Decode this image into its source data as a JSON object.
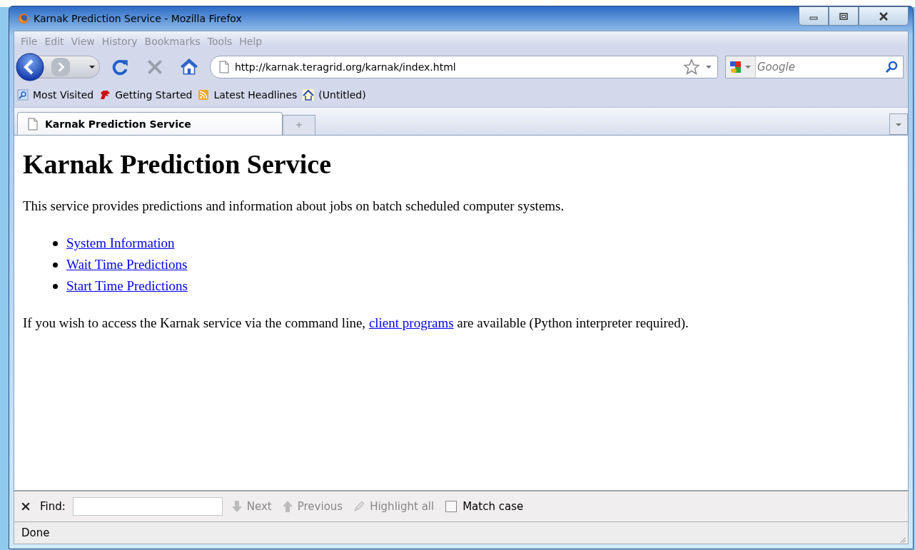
{
  "window": {
    "title": "Karnak Prediction Service - Mozilla Firefox"
  },
  "menu": [
    "File",
    "Edit",
    "View",
    "History",
    "Bookmarks",
    "Tools",
    "Help"
  ],
  "address": {
    "value": "http://karnak.teragrid.org/karnak/index.html"
  },
  "search": {
    "placeholder": "Google"
  },
  "bookmarks": [
    {
      "label": "Most Visited",
      "kind": "search"
    },
    {
      "label": "Getting Started",
      "kind": "dino"
    },
    {
      "label": "Latest Headlines",
      "kind": "feed"
    },
    {
      "label": "(Untitled)",
      "kind": "home"
    }
  ],
  "tabs": [
    {
      "label": "Karnak Prediction Service",
      "selected": true
    }
  ],
  "page": {
    "heading": "Karnak Prediction Service",
    "intro": "This service provides predictions and information about jobs on batch scheduled computer systems.",
    "links": [
      "System Information",
      "Wait Time Predictions",
      "Start Time Predictions"
    ],
    "footer_before": "If you wish to access the Karnak service via the command line,",
    "footer_link": "client programs",
    "footer_after": "are available (Python interpreter required)."
  },
  "find_bar": {
    "label": "Find:",
    "next": "Next",
    "previous": "Previous",
    "highlight": "Highlight all",
    "match_case": {
      "label": "Match case",
      "checked": false
    }
  },
  "status_bar": {
    "text": "Done"
  }
}
